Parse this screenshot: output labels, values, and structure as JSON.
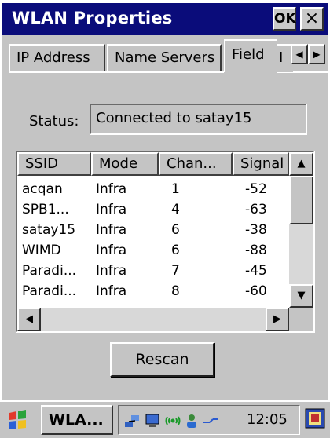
{
  "window": {
    "title": "WLAN Properties",
    "ok_label": "OK",
    "close_label": "×"
  },
  "tabs": [
    {
      "label": "IP Address"
    },
    {
      "label": "Name Servers"
    },
    {
      "label": "Field",
      "selected": true
    },
    {
      "label": "I"
    }
  ],
  "tab_scroll": {
    "left": "◀",
    "right": "▶"
  },
  "status": {
    "label": "Status:",
    "value": "Connected to satay15"
  },
  "networks": {
    "columns": [
      "SSID",
      "Mode",
      "Chan...",
      "Signal"
    ],
    "rows": [
      [
        "acqan",
        "Infra",
        "1",
        "-52"
      ],
      [
        "SPB1...",
        "Infra",
        "4",
        "-63"
      ],
      [
        "satay15",
        "Infra",
        "6",
        "-38"
      ],
      [
        "WIMD",
        "Infra",
        "6",
        "-88"
      ],
      [
        "Paradi...",
        "Infra",
        "7",
        "-45"
      ],
      [
        "Paradi...",
        "Infra",
        "8",
        "-60"
      ]
    ]
  },
  "scroll_glyphs": {
    "up": "▲",
    "down": "▼",
    "left": "◀",
    "right": "▶"
  },
  "rescan_label": "Rescan",
  "taskbar": {
    "task_label": "WLA...",
    "clock": "12:05",
    "tray_icons": [
      "network-connection-icon",
      "display-icon",
      "wireless-signal-icon",
      "user-icon",
      "connection-arrows-icon"
    ],
    "language_icon": "input-language-icon"
  },
  "colors": {
    "title_bar": "#0a0c7a",
    "face": "#c4c4c4"
  }
}
